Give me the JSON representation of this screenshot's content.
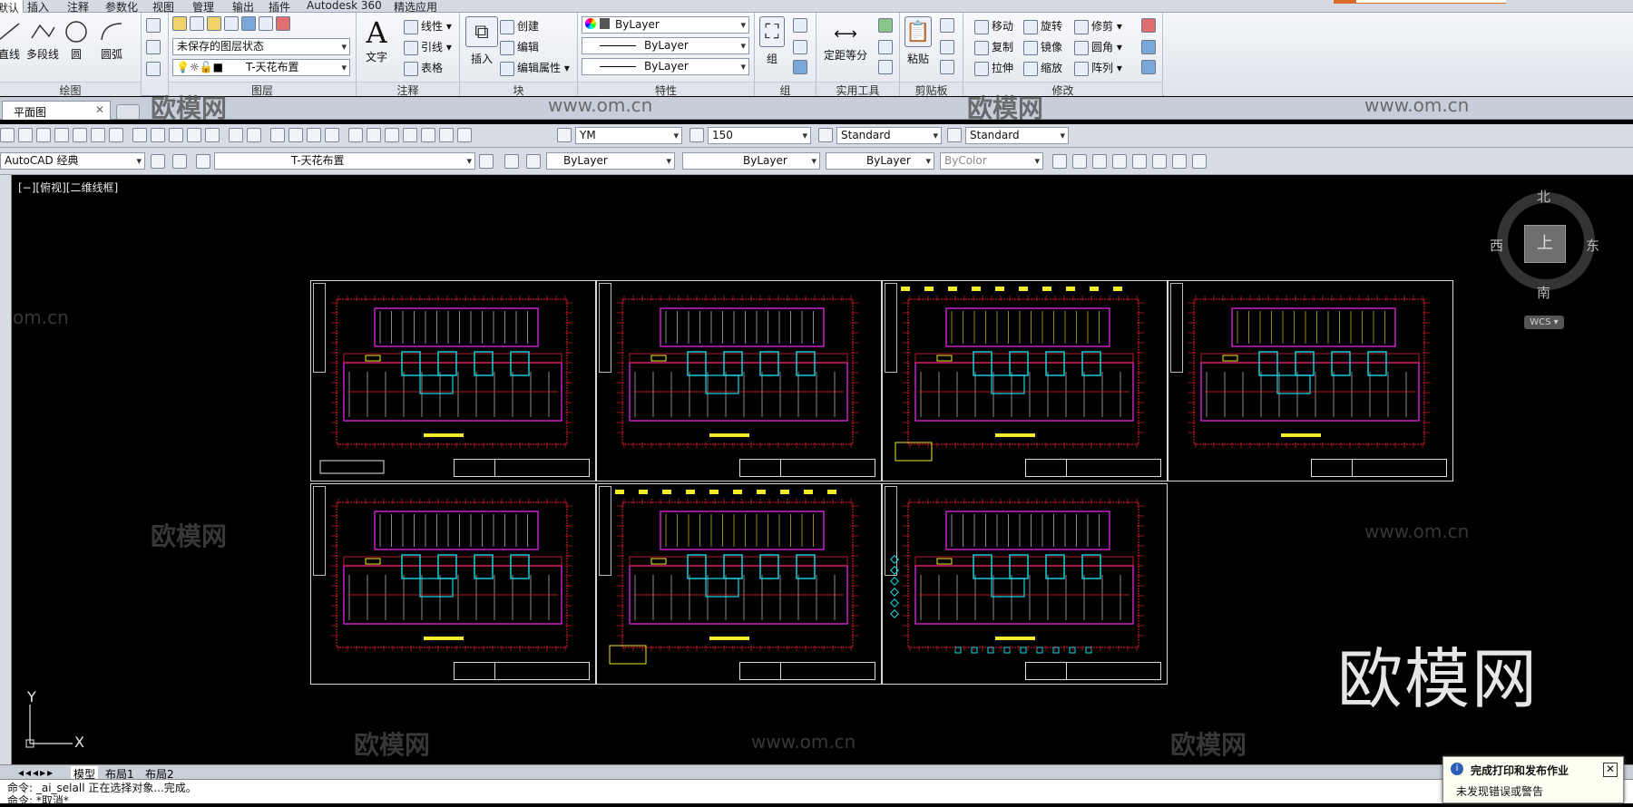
{
  "ribbon_tabs": [
    "默认",
    "插入",
    "注释",
    "参数化",
    "视图",
    "管理",
    "输出",
    "插件",
    "Autodesk 360",
    "精选应用"
  ],
  "draw": {
    "title": "绘图",
    "tools": [
      "直线",
      "多段线",
      "圆",
      "圆弧"
    ]
  },
  "layers": {
    "title": "图层",
    "state": "未保存的图层状态",
    "current": "T-天花布置"
  },
  "annotation": {
    "title": "注释",
    "text_label": "文字",
    "linear": "线性",
    "leader": "引线",
    "table": "表格"
  },
  "block": {
    "title": "块",
    "insert": "插入",
    "create": "创建",
    "edit": "编辑",
    "edit_attr": "编辑属性"
  },
  "properties": {
    "title": "特性",
    "color": "ByLayer",
    "linetype": "ByLayer",
    "lineweight": "ByLayer"
  },
  "groups": {
    "title": "组",
    "group": "组"
  },
  "utilities": {
    "title": "实用工具",
    "measure": "定距等分"
  },
  "clipboard": {
    "title": "剪贴板",
    "paste": "粘贴"
  },
  "modify": {
    "title": "修改",
    "items": [
      "移动",
      "旋转",
      "修剪",
      "复制",
      "镜像",
      "圆角",
      "拉伸",
      "缩放",
      "阵列"
    ]
  },
  "document_tab": {
    "label": "平面图"
  },
  "styles_toolbar": {
    "text_style": "YM",
    "dim_scale": "150",
    "dim_style": "Standard",
    "table_style": "Standard"
  },
  "workspace_toolbar": {
    "workspace": "AutoCAD 经典",
    "layer": "T-天花布置",
    "color": "ByLayer",
    "linetype": "ByLayer",
    "lineweight": "ByLayer",
    "plotstyle": "ByColor"
  },
  "viewport": {
    "label": "[−][俯视][二维线框]",
    "compass": {
      "north": "北",
      "south": "南",
      "east": "东",
      "west": "西",
      "top": "上"
    },
    "wcs": "WCS ▾",
    "ucs_x": "X",
    "ucs_y": "Y"
  },
  "watermark": {
    "big": "欧模网",
    "small_cn": "欧模网",
    "small_url": "www.om.cn",
    "url_partial": "om.cn"
  },
  "layout_tabs": [
    "模型",
    "布局1",
    "布局2"
  ],
  "command_lines": [
    "命令: _ai_selall 正在选择对象...完成。",
    "命令: *取消*"
  ],
  "notification": {
    "title": "完成打印和发布作业",
    "body": "未发现错误或警告",
    "close": "✕"
  },
  "accent": {
    "cad_red": "#e8202a",
    "cad_magenta": "#c61fc6",
    "cad_cyan": "#18d8e8",
    "cad_yellow": "#f2ea2a",
    "cad_white": "#e6e6e6"
  }
}
